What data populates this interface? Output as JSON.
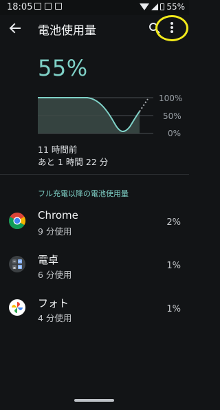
{
  "status_bar": {
    "time": "18:05",
    "battery_percent": "55%",
    "icons": [
      "image-icon",
      "calendar-icon",
      "mail-icon",
      "wifi-icon",
      "signal-icon",
      "battery-icon"
    ]
  },
  "app_bar": {
    "title": "電池使用量",
    "back_icon": "back-arrow-icon",
    "search_icon": "search-icon",
    "more_icon": "more-vert-icon"
  },
  "battery": {
    "level": "55%",
    "chart_labels": [
      "100%",
      "50%",
      "0%"
    ],
    "time_ago": "11 時間前",
    "remaining": "あと 1 時間 22 分"
  },
  "section": {
    "title": "フル充電以降の電池使用量"
  },
  "apps": [
    {
      "name": "Chrome",
      "usage": "9 分使用",
      "percent": "2%",
      "icon": "chrome-icon"
    },
    {
      "name": "電卓",
      "usage": "6 分使用",
      "percent": "1%",
      "icon": "calculator-icon"
    },
    {
      "name": "フォト",
      "usage": "4 分使用",
      "percent": "1%",
      "icon": "photos-icon"
    }
  ],
  "colors": {
    "accent": "#7fd1c7",
    "background": "#121416",
    "highlight": "#f2ea1b"
  }
}
